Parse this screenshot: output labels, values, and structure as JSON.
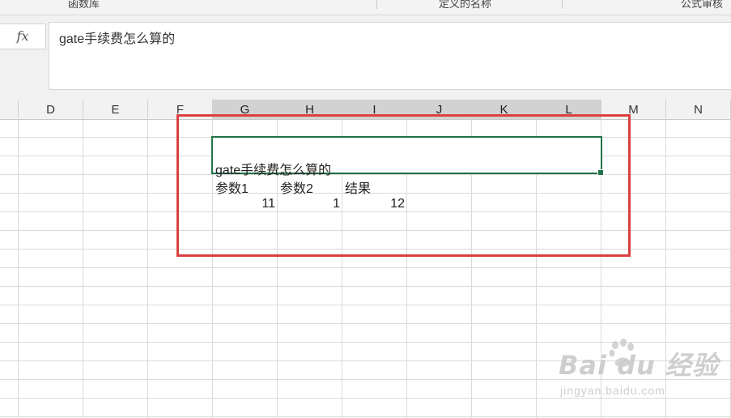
{
  "ribbon": {
    "groups": [
      "函数库",
      "定义的名称",
      "公式审核"
    ]
  },
  "formula_bar": {
    "fx_label": "fx",
    "content": "gate手续费怎么算的"
  },
  "columns": [
    "D",
    "E",
    "F",
    "G",
    "H",
    "I",
    "J",
    "K",
    "L",
    "M",
    "N"
  ],
  "selected_columns": [
    "G",
    "H",
    "I",
    "J",
    "K",
    "L"
  ],
  "cells": {
    "title": "gate手续费怎么算的",
    "header_param1": "参数1",
    "header_param2": "参数2",
    "header_result": "结果",
    "value_param1": "11",
    "value_param2": "1",
    "value_result": "12"
  },
  "colors": {
    "selection": "#217346",
    "highlight_box": "#d9403f"
  },
  "watermark": {
    "logo": "Bai du 经验",
    "url": "jingyan.baidu.com"
  }
}
